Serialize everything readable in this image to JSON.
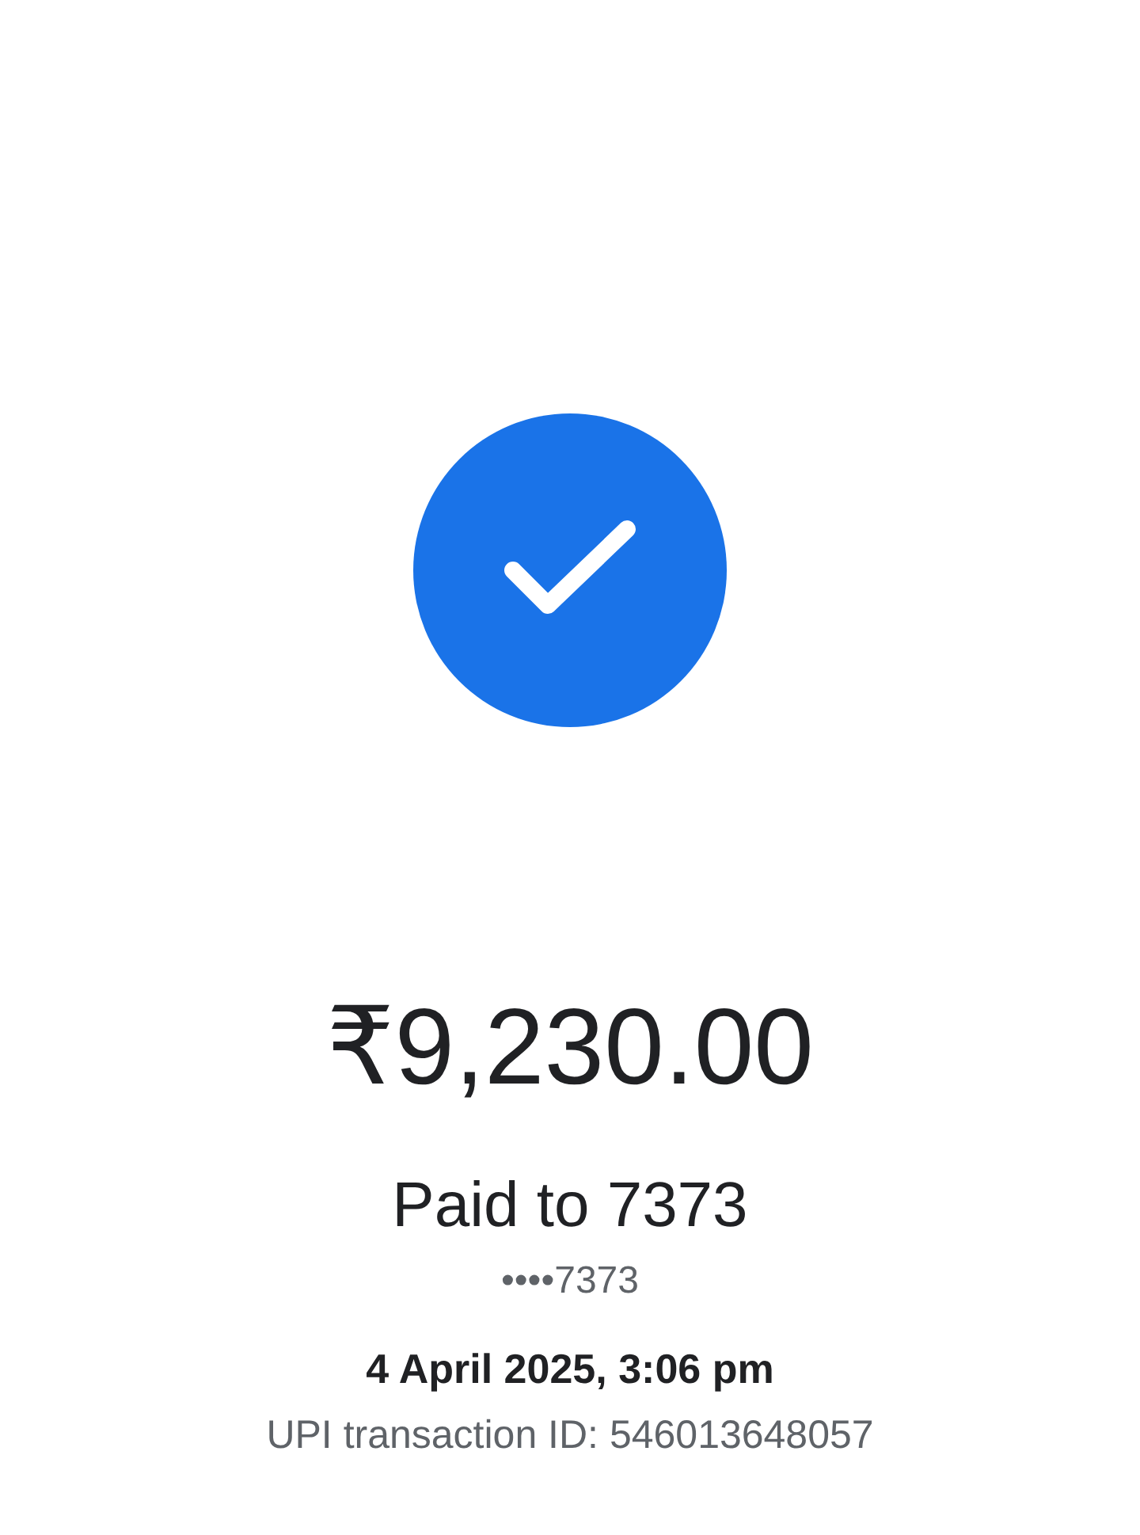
{
  "status": {
    "kind": "success"
  },
  "amount": "₹9,230.00",
  "payee": "Paid to 7373",
  "account": "••••7373",
  "datetime": "4 April 2025, 3:06 pm",
  "transaction_id": "UPI transaction ID: 546013648057"
}
